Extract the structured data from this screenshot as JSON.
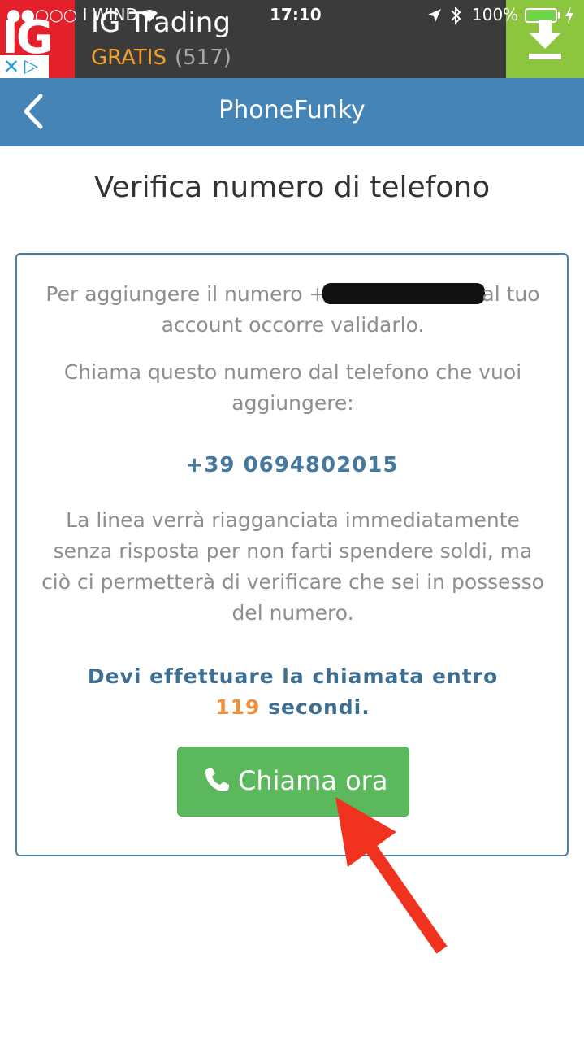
{
  "ad": {
    "logo_text": "IG",
    "title": "IG Trading",
    "price_label": "GRATIS",
    "rating_count": "(517)",
    "close_icon": "✕",
    "adchoices_icon": "▷"
  },
  "status_bar": {
    "carrier": "●●○○○ I WIND",
    "time": "17:10",
    "battery": "100%",
    "battery_level": 1.0
  },
  "navbar": {
    "title": "PhoneFunky",
    "back_icon": "chevron-left-icon"
  },
  "page": {
    "title": "Verifica numero di telefono"
  },
  "card": {
    "intro_before": "Per aggiungere il numero +",
    "intro_after": "al tuo",
    "intro_line2": "account occorre validarlo.",
    "instruction": "Chiama questo numero dal telefono che vuoi aggiungere:",
    "phone_number": "+39 0694802015",
    "explanation": "La linea verrà riagganciata immediatamente senza risposta per non farti spendere soldi, ma ciò ci permetterà di verificare che sei in possesso del numero.",
    "deadline_text": "Devi effettuare la chiamata entro",
    "seconds_value": "119",
    "seconds_label": "secondi.",
    "call_button": "Chiama ora"
  },
  "colors": {
    "navbar": "#4584b6",
    "accent_text": "#44799f",
    "countdown": "#ee8f3c",
    "button": "#5cb85c",
    "annotation_arrow": "#f0321e"
  }
}
